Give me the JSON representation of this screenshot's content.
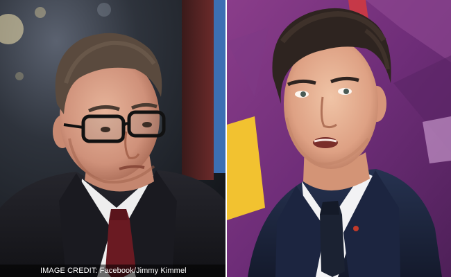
{
  "caption": {
    "credit_text": "IMAGE CREDIT: Facebook/Jimmy Kimmel"
  },
  "colors": {
    "left_background": "#2a2e36",
    "right_background": "#6e2d78",
    "left_suit": "#1c1c22",
    "left_tie": "#6a1a22",
    "right_suit": "#1d2740",
    "right_tie": "#1b2232",
    "accent_yellow": "#f2c230",
    "accent_blue": "#2b5fb0"
  },
  "panels": {
    "left": {
      "subject": "man-glasses-dark-suit"
    },
    "right": {
      "subject": "man-speaking-navy-suit"
    }
  }
}
